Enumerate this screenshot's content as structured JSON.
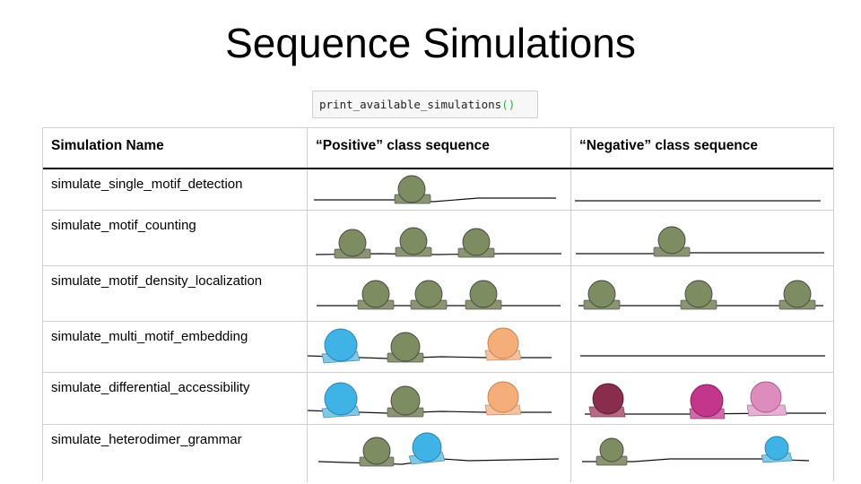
{
  "title": "Sequence Simulations",
  "code": {
    "function": "print_available_simulations",
    "parens": "()"
  },
  "table": {
    "headers": [
      "Simulation Name",
      "“Positive” class sequence",
      "“Negative” class sequence"
    ],
    "rows": [
      {
        "name": "simulate_single_motif_detection",
        "positive": [
          {
            "motif": "green"
          }
        ],
        "negative": []
      },
      {
        "name": "simulate_motif_counting",
        "positive": [
          {
            "motif": "green"
          },
          {
            "motif": "green"
          },
          {
            "motif": "green"
          }
        ],
        "negative": [
          {
            "motif": "green"
          }
        ]
      },
      {
        "name": "simulate_motif_density_localization",
        "positive": [
          {
            "motif": "green"
          },
          {
            "motif": "green"
          },
          {
            "motif": "green"
          }
        ],
        "negative": [
          {
            "motif": "green"
          },
          {
            "motif": "green"
          },
          {
            "motif": "green"
          }
        ]
      },
      {
        "name": "simulate_multi_motif_embedding",
        "positive": [
          {
            "motif": "blue"
          },
          {
            "motif": "green"
          },
          {
            "motif": "orange"
          }
        ],
        "negative": []
      },
      {
        "name": "simulate_differential_accessibility",
        "positive": [
          {
            "motif": "blue"
          },
          {
            "motif": "green"
          },
          {
            "motif": "orange"
          }
        ],
        "negative": [
          {
            "motif": "maroon"
          },
          {
            "motif": "magenta"
          },
          {
            "motif": "pink"
          }
        ]
      },
      {
        "name": "simulate_heterodimer_grammar",
        "positive": [
          {
            "motif": "green"
          },
          {
            "motif": "blue"
          }
        ],
        "negative": [
          {
            "motif": "green-small"
          },
          {
            "motif": "blue-small"
          }
        ]
      }
    ]
  },
  "colors": {
    "green": "#7d8c61",
    "green_base": "#8a9470",
    "blue": "#3fb2e6",
    "blue_base": "#7fc8e8",
    "orange": "#f5ad7a",
    "orange_base": "#f6c29e",
    "maroon": "#8a2c4c",
    "maroon_base": "#b56a85",
    "magenta": "#c2368c",
    "magenta_base": "#d06aa8",
    "pink": "#de8cbe",
    "pink_base": "#e6b0d2"
  }
}
